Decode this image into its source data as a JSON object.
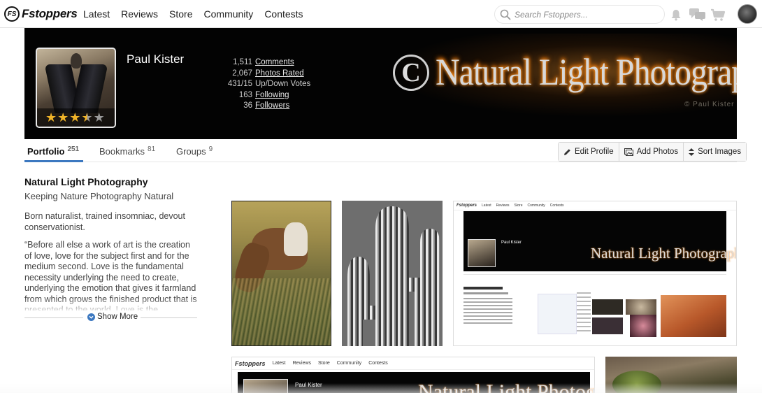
{
  "nav": {
    "logo_badge": "FS",
    "logo_text": "Fstoppers",
    "links": [
      "Latest",
      "Reviews",
      "Store",
      "Community",
      "Contests"
    ],
    "search_placeholder": "Search Fstoppers..."
  },
  "icons": {
    "search": "search-icon",
    "notifications": "bell-icon",
    "messages": "chat-bubbles-icon",
    "cart": "cart-icon",
    "edit": "pencil-icon",
    "add_photos": "photos-icon",
    "sort": "sort-arrows-icon",
    "show_more": "chevron-down-circle-icon"
  },
  "profile": {
    "name": "Paul Kister",
    "rating": 3.5,
    "rating_max": 5,
    "banner_initial": "C",
    "banner_title": "Natural Light Photography",
    "banner_credit": "© Paul Kister",
    "stats": [
      {
        "value": "1,511",
        "label": "Comments",
        "link": true
      },
      {
        "value": "2,067",
        "label": "Photos Rated",
        "link": true
      },
      {
        "value": "431/15",
        "label": "Up/Down Votes",
        "link": false
      },
      {
        "value": "163",
        "label": "Following",
        "link": true
      },
      {
        "value": "36",
        "label": "Followers",
        "link": true
      }
    ]
  },
  "tabs": [
    {
      "label": "Portfolio",
      "count": "251",
      "active": true
    },
    {
      "label": "Bookmarks",
      "count": "81",
      "active": false
    },
    {
      "label": "Groups",
      "count": "9",
      "active": false
    }
  ],
  "actions": {
    "edit_profile": "Edit Profile",
    "add_photos": "Add Photos",
    "sort_images": "Sort Images"
  },
  "about": {
    "title": "Natural Light Photography",
    "subtitle": "Keeping Nature Photography Natural",
    "bio": "Born naturalist, trained insomniac, devout conservationist.",
    "quote": "“Before all else a work of art is the creation of love, love for the subject first and for the medium second. Love is the fundamental necessity underlying the need to create, underlying the emotion that gives it farmland from which grows the finished product that is presented to the world. Love is the",
    "show_more": "Show More"
  },
  "gallery_screens": {
    "mini_name": "Paul Kister",
    "mini_brand": "Natural Light Photography"
  },
  "colors": {
    "accent": "#3c78c0",
    "star": "#f0b429",
    "banner_bg": "#030303"
  }
}
